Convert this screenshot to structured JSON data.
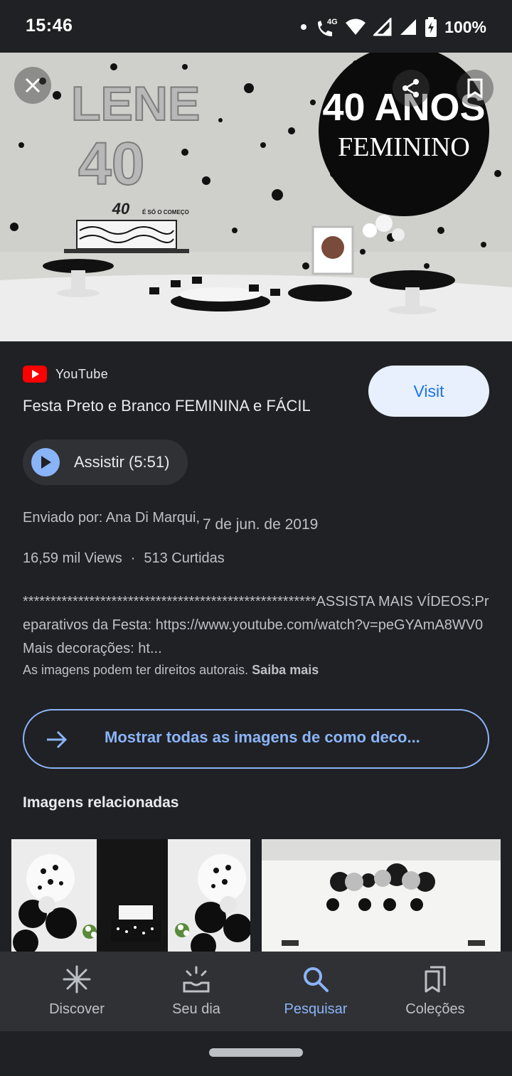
{
  "status_bar": {
    "time": "15:46",
    "network": "4G",
    "battery": "100%"
  },
  "hero": {
    "close_icon": "close-icon",
    "share_icon": "share-icon",
    "bookmark_icon": "bookmark-icon",
    "overlay": {
      "line1": "LENE",
      "line2": "40",
      "badge_line1": "40 ANOS",
      "badge_line2": "FEMININO",
      "cake_topper": "40",
      "cake_topper_small": "É SÓ O COMEÇO"
    }
  },
  "result": {
    "source": "YouTube",
    "title": "Festa Preto e Branco FEMININA e FÁCIL",
    "visit_label": "Visit",
    "watch_label": "Assistir (5:51)",
    "uploaded_by": "Enviado por: Ana Di Marqui,",
    "uploaded_date": "7 de jun. de 2019",
    "views": "16,59 mil Views",
    "likes": "513 Curtidas",
    "description": "*****************************************************ASSISTA MAIS VÍDEOS:Preparativos da Festa: https://www.youtube.com/watch?v=peGYAmA8WV0Mais decorações: ht...",
    "copyright": "As imagens podem ter direitos autorais.",
    "learn_more": "Saiba mais"
  },
  "show_all_label": "Mostrar todas as imagens de como deco...",
  "related_heading": "Imagens relacionadas",
  "bottom_nav": {
    "items": [
      {
        "label": "Discover",
        "icon": "asterisk-icon"
      },
      {
        "label": "Seu dia",
        "icon": "sunrise-icon"
      },
      {
        "label": "Pesquisar",
        "icon": "search-icon"
      },
      {
        "label": "Coleções",
        "icon": "collections-icon"
      }
    ],
    "active": "Pesquisar"
  },
  "colors": {
    "accent": "#8ab4f8",
    "visit_bg": "#e8f0fe",
    "visit_text": "#1a73e8",
    "background": "#202124",
    "youtube_red": "#ff0000"
  }
}
